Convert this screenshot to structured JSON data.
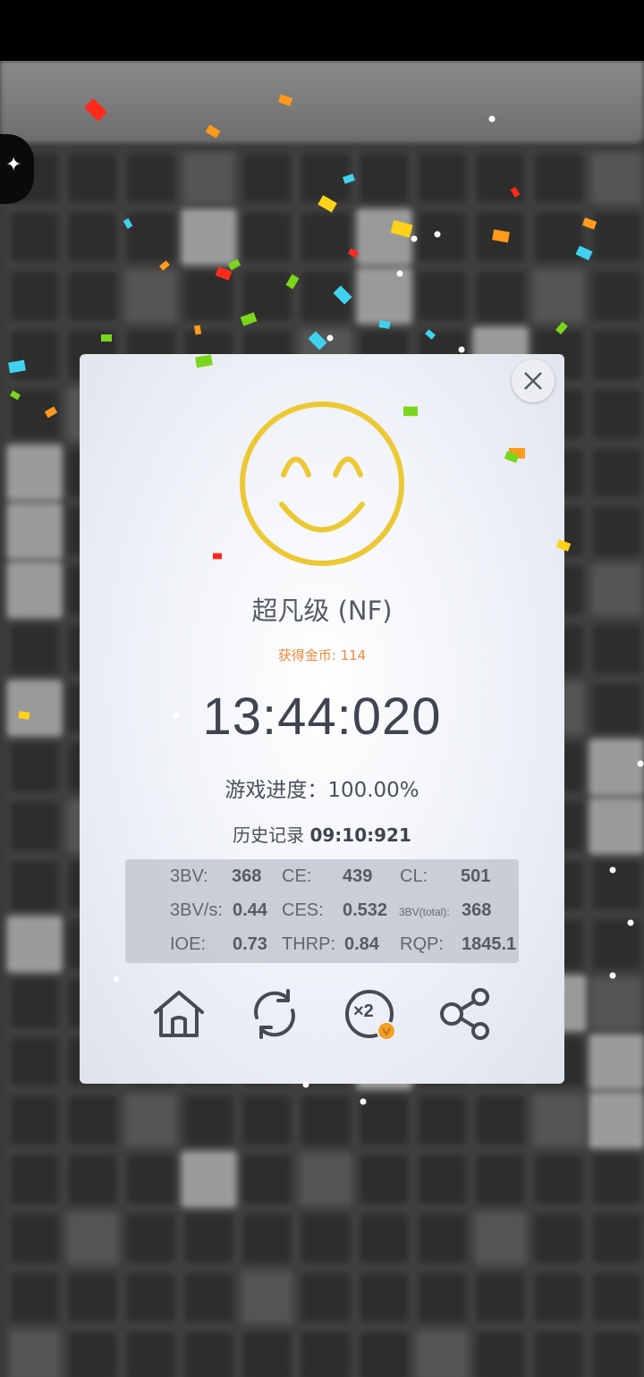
{
  "result": {
    "rank": "超凡级 (NF)",
    "coins_label": "获得金币: ",
    "coins_value": "114",
    "time": "13:44:020",
    "progress_label": "游戏进度：",
    "progress_value": "100.00%",
    "history_label": "历史记录 ",
    "history_value": "09:10:921"
  },
  "stats": {
    "bv_label": "3BV:",
    "bv_value": "368",
    "ce_label": "CE:",
    "ce_value": "439",
    "cl_label": "CL:",
    "cl_value": "501",
    "bvs_label": "3BV/s:",
    "bvs_value": "0.44",
    "ces_label": "CES:",
    "ces_value": "0.532",
    "bvtotal_label": "3BV(total):",
    "bvtotal_value": "368",
    "ioe_label": "IOE:",
    "ioe_value": "0.73",
    "thrp_label": "THRP:",
    "thrp_value": "0.84",
    "rqp_label": "RQP:",
    "rqp_value": "1845.1"
  },
  "actions": {
    "double_label": "×2"
  },
  "icons": {
    "smiley": "smiley-face-icon",
    "close": "close-icon",
    "home": "home-icon",
    "replay": "replay-icon",
    "double": "double-reward-icon",
    "share": "share-icon",
    "side": "puzzle-icon"
  },
  "colors": {
    "smiley": "#ecc833",
    "coins": "#f08a3c",
    "icon": "#454a55",
    "coin_badge": "#f0a02a"
  }
}
